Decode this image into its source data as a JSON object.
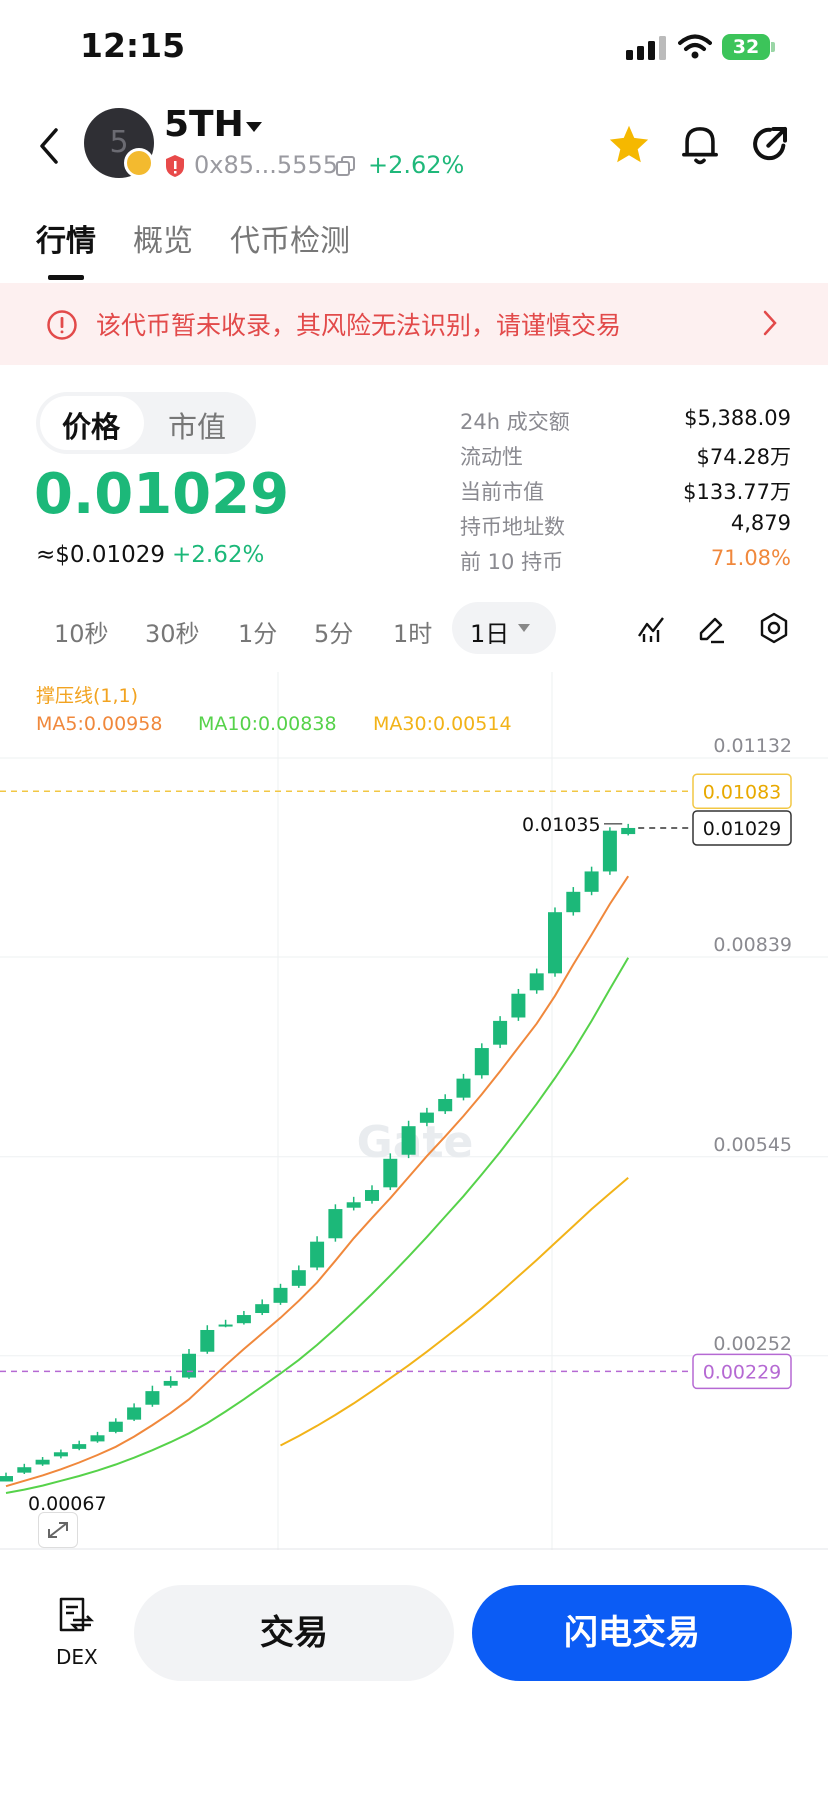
{
  "status_bar": {
    "time": "12:15",
    "battery": "32"
  },
  "header": {
    "avatar_letter": "5",
    "token_name": "5TH",
    "address": "0x85...5555",
    "change": "+2.62%"
  },
  "tabs": [
    {
      "label": "行情"
    },
    {
      "label": "概览"
    },
    {
      "label": "代币检测"
    }
  ],
  "warning": {
    "text": "该代币暂未收录，其风险无法识别，请谨慎交易"
  },
  "price_toggle": {
    "price_label": "价格",
    "mcap_label": "市值"
  },
  "price": {
    "value": "0.01029",
    "usd": "≈$0.01029",
    "change": "+2.62%"
  },
  "stats": [
    {
      "label": "24h 成交额",
      "value": "$5,388.09"
    },
    {
      "label": "流动性",
      "value": "$74.28万"
    },
    {
      "label": "当前市值",
      "value": "$133.77万"
    },
    {
      "label": "持币地址数",
      "value": "4,879"
    },
    {
      "label": "前 10 持币",
      "value": "71.08%"
    }
  ],
  "timeframes": {
    "options": [
      "10秒",
      "30秒",
      "1分",
      "5分",
      "1时"
    ],
    "selected": "1日"
  },
  "colors": {
    "up": "#1cb879",
    "ma5": "#f0883c",
    "ma10": "#56d24a",
    "ma30": "#f2b318",
    "resistance": "#f2c744",
    "support": "#b569d3",
    "flash_button": "#0b5cf5",
    "warning_text": "#e24a4a",
    "star": "#f5b800"
  },
  "chart_legend": {
    "indicator": "撑压线(1,1)",
    "ma5": "MA5:0.00958",
    "ma10": "MA10:0.00838",
    "ma30": "MA30:0.00514"
  },
  "chart_data": {
    "type": "candlestick",
    "y_ticks": [
      "0.01132",
      "0.00839",
      "0.00545",
      "0.00252"
    ],
    "ylim": [
      0.0,
      0.0121
    ],
    "resistance": 0.01083,
    "support": 0.00229,
    "current_price": 0.01029,
    "high_marker": "0.01035",
    "low_marker": "0.00067",
    "watermark": "Gate",
    "candles": [
      [
        0.00067,
        0.00075,
        0.0008,
        0.00067
      ],
      [
        0.0008,
        0.00088,
        0.00093,
        0.00078
      ],
      [
        0.00092,
        0.00099,
        0.00103,
        0.0009
      ],
      [
        0.00104,
        0.0011,
        0.00114,
        0.00101
      ],
      [
        0.00115,
        0.00122,
        0.00127,
        0.00113
      ],
      [
        0.00126,
        0.00135,
        0.0014,
        0.00124
      ],
      [
        0.0014,
        0.00155,
        0.0016,
        0.00138
      ],
      [
        0.00158,
        0.00176,
        0.00182,
        0.00156
      ],
      [
        0.0018,
        0.002,
        0.00208,
        0.00177
      ],
      [
        0.00208,
        0.00215,
        0.00222,
        0.00205
      ],
      [
        0.0022,
        0.00255,
        0.00262,
        0.00218
      ],
      [
        0.00258,
        0.0029,
        0.00297,
        0.00255
      ],
      [
        0.00296,
        0.00298,
        0.00305,
        0.00294
      ],
      [
        0.003,
        0.00312,
        0.00318,
        0.00298
      ],
      [
        0.00315,
        0.00328,
        0.00335,
        0.00312
      ],
      [
        0.0033,
        0.00352,
        0.00358,
        0.00327
      ],
      [
        0.00355,
        0.00378,
        0.00385,
        0.00352
      ],
      [
        0.00382,
        0.0042,
        0.00428,
        0.00378
      ],
      [
        0.00425,
        0.00468,
        0.00475,
        0.0042
      ],
      [
        0.0047,
        0.00478,
        0.00486,
        0.00466
      ],
      [
        0.0048,
        0.00496,
        0.00503,
        0.00476
      ],
      [
        0.005,
        0.00542,
        0.0055,
        0.00496
      ],
      [
        0.00548,
        0.0059,
        0.00598,
        0.00543
      ],
      [
        0.00595,
        0.0061,
        0.00617,
        0.0059
      ],
      [
        0.00612,
        0.0063,
        0.00637,
        0.00608
      ],
      [
        0.00632,
        0.0066,
        0.00667,
        0.00628
      ],
      [
        0.00665,
        0.00705,
        0.00712,
        0.0066
      ],
      [
        0.0071,
        0.00745,
        0.00752,
        0.00705
      ],
      [
        0.0075,
        0.00785,
        0.00792,
        0.00745
      ],
      [
        0.0079,
        0.00815,
        0.00822,
        0.00785
      ],
      [
        0.00815,
        0.00905,
        0.00912,
        0.0081
      ],
      [
        0.00905,
        0.00935,
        0.00942,
        0.009
      ],
      [
        0.00935,
        0.00965,
        0.00972,
        0.0093
      ],
      [
        0.00965,
        0.01025,
        0.0103,
        0.0096
      ],
      [
        0.0102,
        0.01029,
        0.01035,
        0.01018
      ]
    ],
    "ma5": [
      0.0006,
      0.00068,
      0.00076,
      0.00085,
      0.00095,
      0.00106,
      0.00118,
      0.00133,
      0.0015,
      0.00168,
      0.00188,
      0.00213,
      0.00238,
      0.00262,
      0.00285,
      0.00308,
      0.00333,
      0.0036,
      0.00392,
      0.00425,
      0.00455,
      0.00484,
      0.00515,
      0.00546,
      0.00575,
      0.00605,
      0.00637,
      0.00671,
      0.00706,
      0.00741,
      0.00782,
      0.00828,
      0.00872,
      0.00917,
      0.00958
    ],
    "ma10": [
      0.0005,
      0.00055,
      0.00061,
      0.00068,
      0.00075,
      0.00083,
      0.00092,
      0.00102,
      0.00113,
      0.00125,
      0.00138,
      0.00153,
      0.0017,
      0.00188,
      0.00207,
      0.00226,
      0.00246,
      0.00268,
      0.00292,
      0.00317,
      0.00343,
      0.0037,
      0.00398,
      0.00427,
      0.00457,
      0.00487,
      0.00519,
      0.00552,
      0.00587,
      0.00623,
      0.00661,
      0.00701,
      0.00745,
      0.00792,
      0.00838
    ],
    "ma30": [
      null,
      null,
      null,
      null,
      null,
      null,
      null,
      null,
      null,
      null,
      null,
      null,
      null,
      null,
      null,
      0.0012,
      0.00134,
      0.00149,
      0.00165,
      0.00182,
      0.002,
      0.00219,
      0.00238,
      0.00258,
      0.00279,
      0.003,
      0.00322,
      0.00345,
      0.00369,
      0.00393,
      0.00418,
      0.00443,
      0.00468,
      0.00491,
      0.00514
    ]
  },
  "bottom_bar": {
    "dex_label": "DEX",
    "trade_label": "交易",
    "flash_trade_label": "闪电交易"
  }
}
